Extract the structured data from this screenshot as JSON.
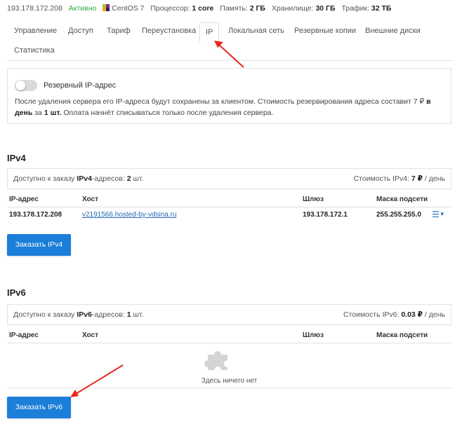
{
  "status": {
    "ip": "193.178.172.208",
    "state": "Активно",
    "os": "CentOS 7",
    "cpu_label": "Процессор:",
    "cpu_value": "1 core",
    "ram_label": "Память:",
    "ram_value": "2 ГБ",
    "storage_label": "Хранилище:",
    "storage_value": "30 ГБ",
    "traffic_label": "Трафик:",
    "traffic_value": "32 ТБ"
  },
  "tabs": [
    {
      "label": "Управление"
    },
    {
      "label": "Доступ"
    },
    {
      "label": "Тариф"
    },
    {
      "label": "Переустановка"
    },
    {
      "label": "IP"
    },
    {
      "label": "Локальная сеть"
    },
    {
      "label": "Резервные копии"
    },
    {
      "label": "Внешние диски"
    },
    {
      "label": "Статистика"
    }
  ],
  "reserved": {
    "toggle_label": "Резервный IP-адрес",
    "desc_part1": "После удаления сервера его IP-адреса будут сохранены за клиентом. Стоимость резервирования адреса составит 7 ₽ ",
    "desc_bold1": "в день",
    "desc_part2": " за ",
    "desc_bold2": "1 шт.",
    "desc_part3": " Оплата начнёт списываться только после удаления сервера."
  },
  "ipv4": {
    "title": "IPv4",
    "avail_prefix": "Доступно к заказу ",
    "avail_bold": "IPv4",
    "avail_mid": "-адресов: ",
    "avail_count": "2",
    "avail_suffix": " шт.",
    "cost_prefix": "Стоимость IPv4: ",
    "cost_value": "7 ₽",
    "cost_suffix": " / день",
    "columns": [
      "IP-адрес",
      "Хост",
      "Шлюз",
      "Маска подсети"
    ],
    "rows": [
      {
        "ip": "193.178.172.208",
        "host": "v2191566.hosted-by-vdsina.ru",
        "gateway": "193.178.172.1",
        "mask": "255.255.255.0"
      }
    ],
    "button": "Заказать IPv4"
  },
  "ipv6": {
    "title": "IPv6",
    "avail_prefix": "Доступно к заказу ",
    "avail_bold": "IPv6",
    "avail_mid": "-адресов: ",
    "avail_count": "1",
    "avail_suffix": " шт.",
    "cost_prefix": "Стоимость IPv6: ",
    "cost_value": "0.03 ₽",
    "cost_suffix": " / день",
    "columns": [
      "IP-адрес",
      "Хост",
      "Шлюз",
      "Маска подсети"
    ],
    "empty_text": "Здесь ничего нет",
    "button": "Заказать IPv6"
  },
  "colors": {
    "accent": "#1b7ed8",
    "active_status": "#2eab3a",
    "annotation_arrow": "#e8261c"
  },
  "icons": {
    "os": "centos-logo-icon",
    "row_menu": "hamburger-dropdown-icon",
    "empty": "puzzle-piece-icon"
  }
}
